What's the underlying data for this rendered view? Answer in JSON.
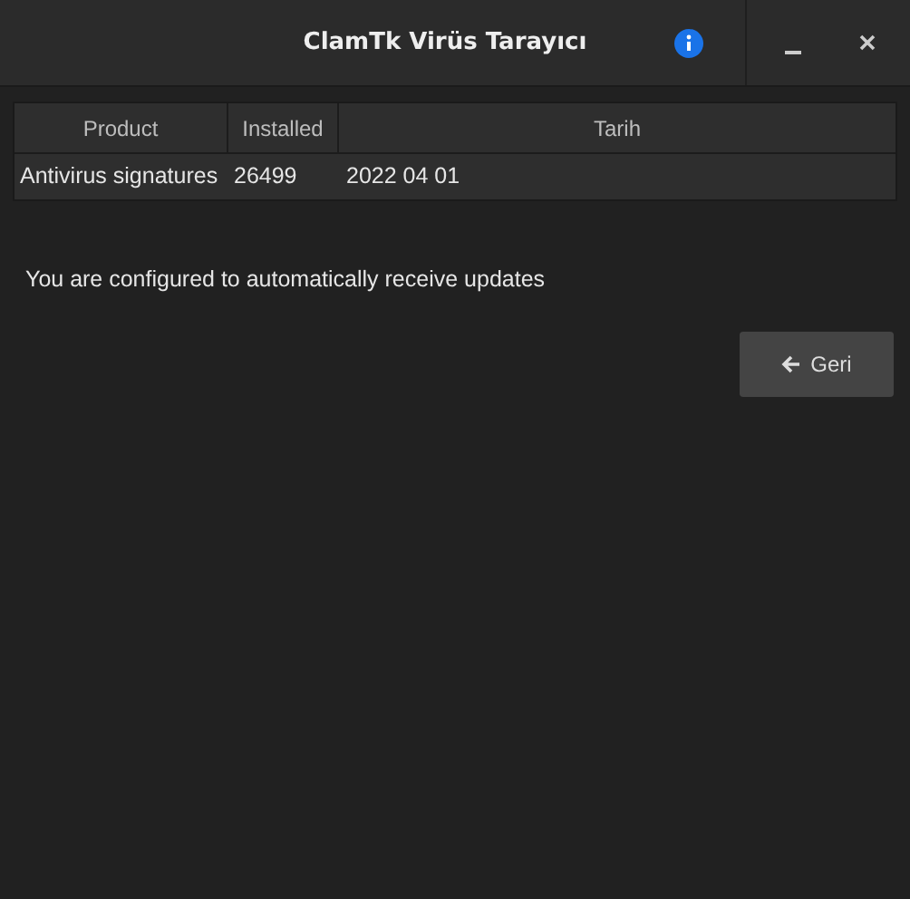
{
  "window": {
    "title": "ClamTk Virüs Tarayıcı"
  },
  "table": {
    "columns": [
      "Product",
      "Installed",
      "Tarih"
    ],
    "rows": [
      [
        "Antivirus signatures",
        "26499",
        "2022 04 01"
      ]
    ]
  },
  "message": "You are configured to automatically receive updates",
  "back_button": {
    "label": "Geri"
  }
}
